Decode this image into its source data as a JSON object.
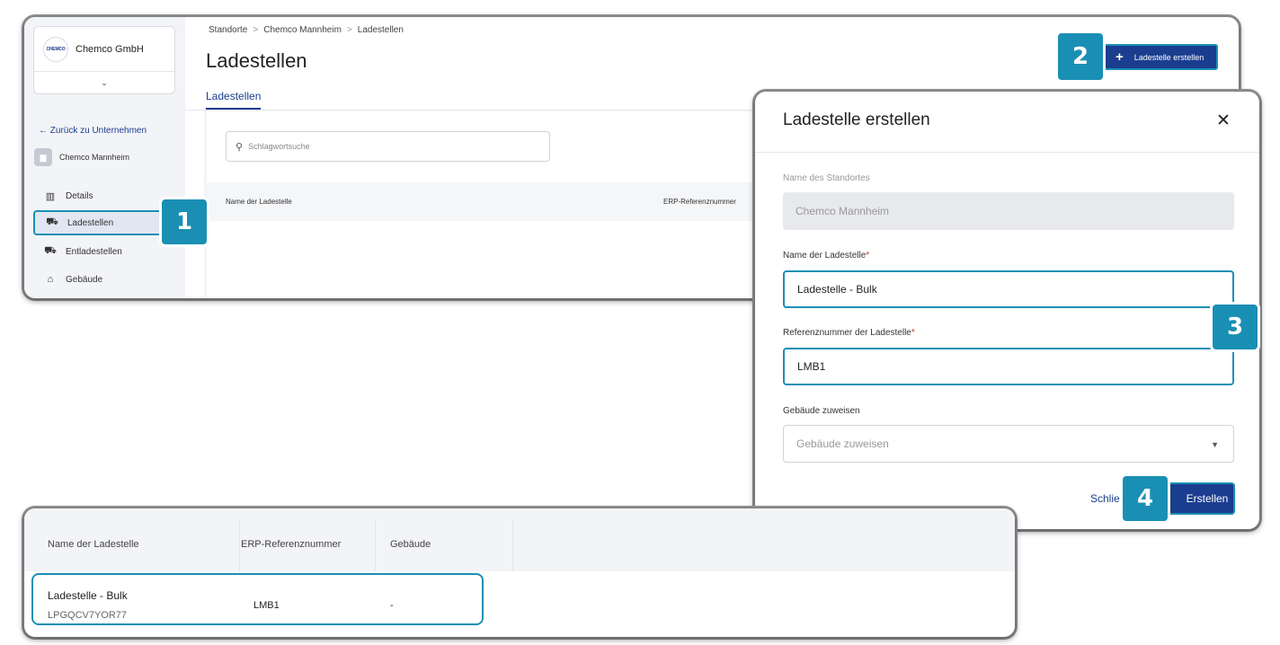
{
  "org": {
    "logo_text": "CHEMCO",
    "name": "Chemco GmbH"
  },
  "sidebar": {
    "back_label": "← Zurück zu Unternehmen",
    "location": "Chemco Mannheim",
    "items": [
      {
        "label": "Details",
        "icon": "building-icon"
      },
      {
        "label": "Ladestellen",
        "icon": "truck-icon"
      },
      {
        "label": "Entladestellen",
        "icon": "truck-icon"
      },
      {
        "label": "Gebäude",
        "icon": "warehouse-icon"
      }
    ]
  },
  "breadcrumb": [
    "Standorte",
    "Chemco Mannheim",
    "Ladestellen"
  ],
  "page": {
    "title": "Ladestellen",
    "tab": "Ladestellen",
    "create_button": "Ladestelle erstellen",
    "search_placeholder": "Schlagwortsuche",
    "columns": [
      "Name der Ladestelle",
      "ERP-Referenznummer"
    ]
  },
  "dialog": {
    "title": "Ladestelle erstellen",
    "close": "✕",
    "site_label": "Name des Standortes",
    "site_value": "Chemco Mannheim",
    "name_label": "Name der Ladestelle",
    "name_value": "Ladestelle - Bulk",
    "ref_label": "Referenznummer der Ladestelle",
    "ref_value": "LMB1",
    "building_label": "Gebäude zuweisen",
    "building_placeholder": "Gebäude zuweisen",
    "required_mark": "*",
    "cancel": "Schlie",
    "submit": "Erstellen"
  },
  "result_table": {
    "columns": [
      "Name der Ladestelle",
      "ERP-Referenznummer",
      "Gebäude"
    ],
    "row": {
      "name": "Ladestelle - Bulk",
      "id": "LPGQCV7YOR77",
      "erp": "LMB1",
      "building": "-"
    }
  },
  "steps": [
    "1",
    "2",
    "3",
    "4"
  ],
  "colors": {
    "primary": "#1a3d8f",
    "highlight": "#1a8fb4"
  }
}
